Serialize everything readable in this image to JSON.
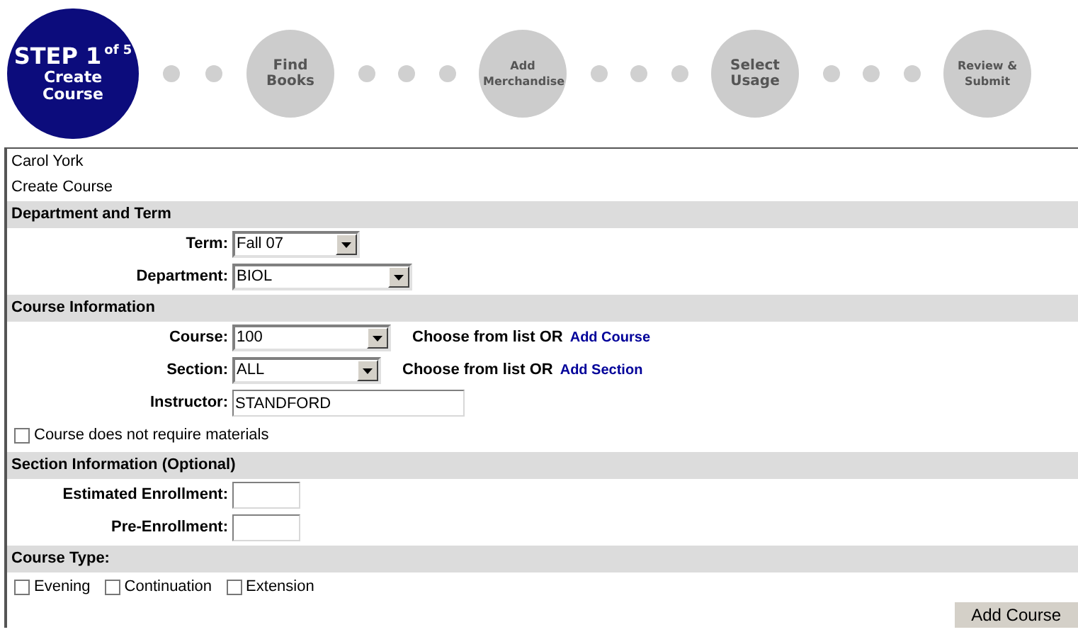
{
  "steps": [
    {
      "kind": "current",
      "title": "STEP 1",
      "suffix": "of 5",
      "label": "Create Course",
      "selected": true
    },
    {
      "kind": "step",
      "label": "Find Books",
      "selected": false
    },
    {
      "kind": "step",
      "label": "Add Merchandise",
      "selected": false
    },
    {
      "kind": "step",
      "label": "Select Usage",
      "selected": false
    },
    {
      "kind": "step",
      "label": "Review & Submit",
      "selected": false
    }
  ],
  "user": "Carol York",
  "page_title": "Create Course",
  "sections": [
    {
      "title": "Department and Term",
      "fields": [
        {
          "kind": "select",
          "label": "Term:",
          "value": "Fall 07"
        },
        {
          "kind": "select",
          "label": "Department:",
          "value": "BIOL"
        }
      ]
    },
    {
      "title": "Course Information",
      "fields": [
        {
          "kind": "select",
          "label": "Course:",
          "value": "100",
          "hint": "Choose from list OR",
          "link": "Add Course"
        },
        {
          "kind": "select",
          "label": "Section:",
          "value": "ALL",
          "hint": "Choose from list OR",
          "link": "Add Section"
        },
        {
          "kind": "text",
          "label": "Instructor:",
          "value": "STANDFORD"
        },
        {
          "kind": "checkbox",
          "label": "Course does not require materials",
          "checked": false
        }
      ]
    },
    {
      "title": "Section Information (Optional)",
      "fields": [
        {
          "kind": "text",
          "label": "Estimated Enrollment:"
        },
        {
          "kind": "text",
          "label": "Pre-Enrollment:"
        }
      ]
    },
    {
      "title": "Course Type:",
      "fields": [
        {
          "kind": "checkboxes",
          "options": [
            {
              "label": "Evening",
              "checked": false
            },
            {
              "label": "Continuation",
              "checked": false
            },
            {
              "label": "Extension",
              "checked": false
            }
          ]
        }
      ]
    }
  ],
  "submit_button": "Add Course"
}
